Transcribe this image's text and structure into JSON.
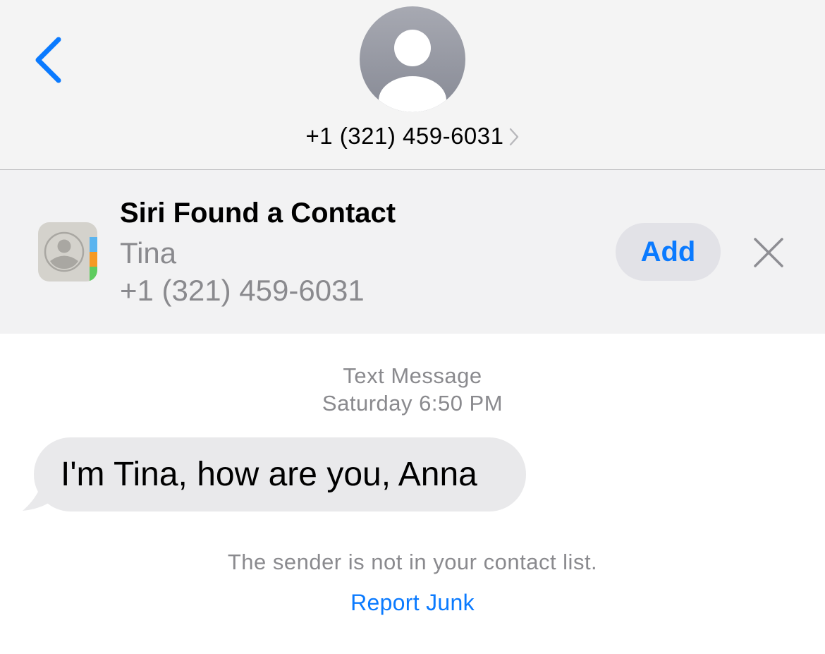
{
  "header": {
    "back_icon": "chevron-left-icon",
    "avatar_icon": "person-silhouette-icon",
    "contact_number": "+1 (321) 459-6031",
    "contact_chevron_icon": "chevron-right-icon"
  },
  "siri_suggestion": {
    "app_icon": "contacts-app-icon",
    "title": "Siri Found a Contact",
    "name": "Tina",
    "number": "+1 (321) 459-6031",
    "add_label": "Add",
    "dismiss_icon": "close-icon"
  },
  "conversation": {
    "service": "Text Message",
    "timestamp": "Saturday 6:50 PM",
    "messages": [
      {
        "direction": "incoming",
        "text": "I'm Tina, how are you, Anna"
      }
    ],
    "unknown_sender_note": "The sender is not in your contact list.",
    "report_junk_label": "Report Junk"
  },
  "colors": {
    "accent": "#0a7aff",
    "header_bg": "#f4f4f4",
    "banner_bg": "#f2f2f3",
    "incoming_bubble": "#e9e9eb",
    "secondary_text": "#8a8a8e",
    "add_button_bg": "#e2e2e7"
  }
}
